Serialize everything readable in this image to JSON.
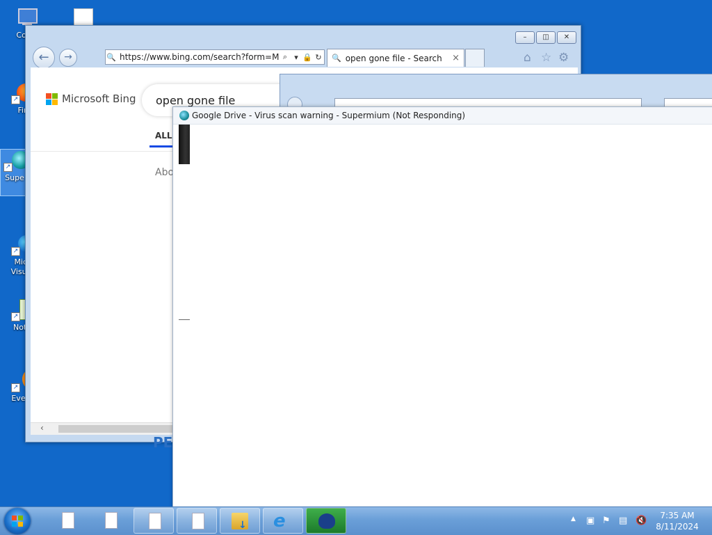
{
  "desktop": {
    "icons": [
      {
        "label": "Com"
      },
      {
        "label": ""
      },
      {
        "label": "Fir"
      },
      {
        "label": "Supe"
      },
      {
        "label": "Micr Visual"
      },
      {
        "label": "Note"
      },
      {
        "label": "Every"
      }
    ]
  },
  "ie_window": {
    "address": "https://www.bing.com/search?form=MO",
    "tab_title": "open gone file - Search",
    "tab_close": "×",
    "page": {
      "logo_text": "Microsoft Bing",
      "search_query": "open gone file",
      "nav_all": "ALL",
      "about_text": "Abo",
      "bottom_text": "PE"
    },
    "caption_buttons": {
      "minimize": "–",
      "restore": "◫",
      "close": "✕"
    }
  },
  "supermium_window": {
    "title": "Google Drive - Virus scan warning - Supermium (Not Responding)"
  },
  "taskbar": {
    "clock_time": "7:35 AM",
    "clock_date": "8/11/2024",
    "tray_expand": "▲"
  },
  "colors": {
    "desktop_bg": "#1168c9",
    "bing_blue": "#174ae4",
    "taskbar": "#6a9fd8"
  }
}
